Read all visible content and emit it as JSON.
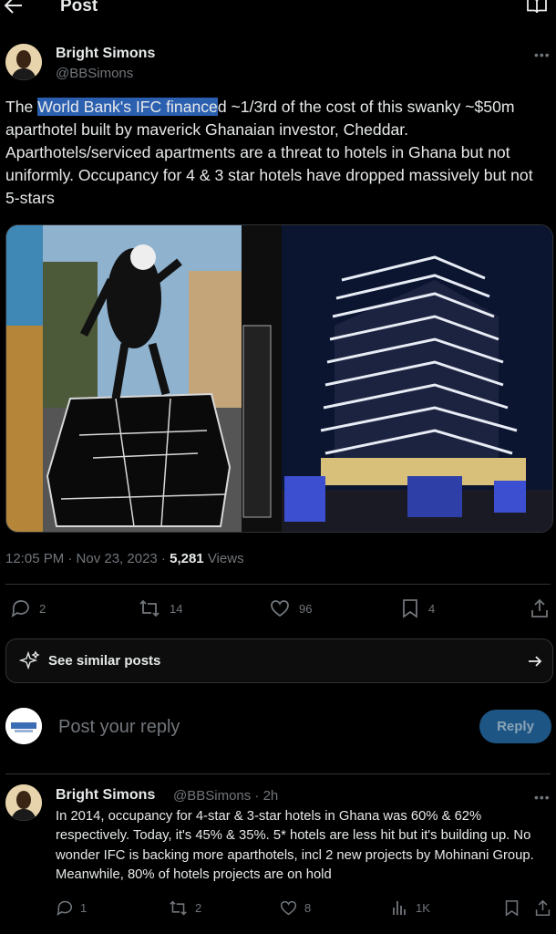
{
  "header": {
    "title": "Post"
  },
  "tweet": {
    "author_name": "Bright Simons",
    "author_handle": "@BBSimons",
    "text_highlighted": "World Bank's IFC finance",
    "text_parts": [
      "The ",
      "d ~1/3rd of the cost of this swanky ~$50m aparthotel built by maverick Ghanaian investor, Cheddar. Aparthotels/serviced apartments are a threat to hotels in Ghana but not uniformly. Occupancy for 4 & 3 star hotels have dropped massively but not 5-stars"
    ],
    "time": "12:05 PM · Nov 23, 2023 · ",
    "views_count": "5,281",
    "views_label": " Views",
    "replies": "2",
    "reposts": "14",
    "likes": "96",
    "bookmarks": "4"
  },
  "similar": {
    "label": "See similar posts"
  },
  "reply_box": {
    "placeholder": "Post your reply",
    "button": "Reply"
  },
  "reply": {
    "author_name": "Bright Simons",
    "author_handle": "@BBSimons · 2h",
    "text": "In 2014, occupancy for 4-star & 3-star hotels in Ghana was 60% & 62% respectively. Today, it's 45% & 35%. 5* hotels are less hit but it's building up. No wonder IFC is backing more aparthotels, incl 2 new projects by Mohinani Group. Meanwhile, 80% of hotels projects are on hold",
    "replies": "1",
    "reposts": "2",
    "likes": "8",
    "views": "1K"
  },
  "colors": {
    "background": "#000000",
    "text": "#e7e9ea",
    "muted": "#71767b",
    "highlight": "#2b5fb0",
    "reply_button": "#1d5585"
  }
}
